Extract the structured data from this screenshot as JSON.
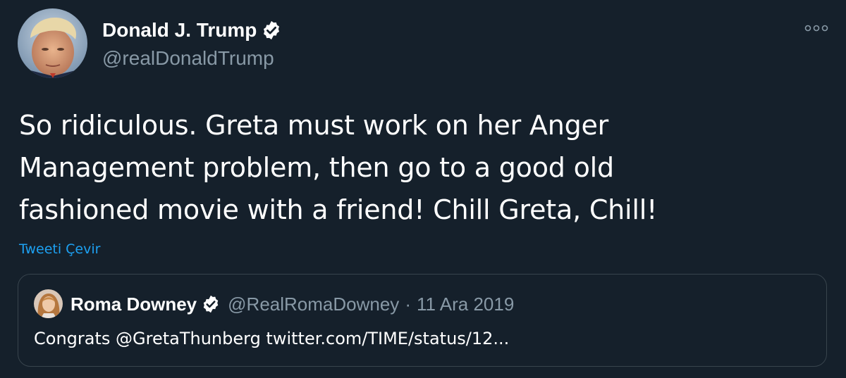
{
  "author": {
    "name": "Donald J. Trump",
    "handle": "@realDonaldTrump",
    "verified_icon": "verified-badge-icon",
    "avatar_icon": "avatar"
  },
  "menu": {
    "icon": "more-options-icon"
  },
  "tweet": {
    "lines": [
      "So ridiculous. Greta must work on her Anger",
      "Management problem, then go to a good old",
      "fashioned movie with a friend! Chill Greta, Chill!"
    ],
    "translate_label": "Tweeti Çevir"
  },
  "quoted_tweet": {
    "name": "Roma Downey",
    "handle": "@RealRomaDowney",
    "separator": "·",
    "date": "11 Ara 2019",
    "text": "Congrats @GretaThunberg twitter.com/TIME/status/12..."
  },
  "colors": {
    "background": "#15202b",
    "text_primary": "#ffffff",
    "text_secondary": "#8899a6",
    "link": "#1da1f2",
    "border": "#38444d"
  }
}
